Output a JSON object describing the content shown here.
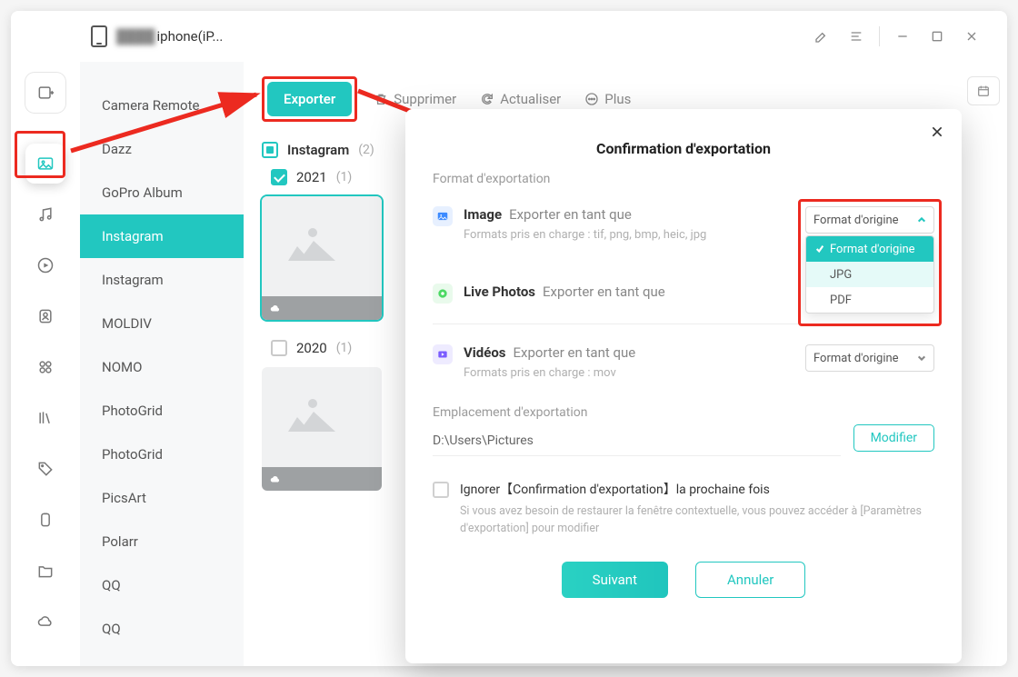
{
  "colors": {
    "accent": "#22c7c0",
    "danger_frame": "#ec2a20"
  },
  "titlebar": {
    "device_name_hidden_prefix": "████",
    "device_name_visible": "iphone(iP..."
  },
  "albums": [
    {
      "label": "Camera Remote",
      "selected": false
    },
    {
      "label": "Dazz",
      "selected": false
    },
    {
      "label": "GoPro Album",
      "selected": false
    },
    {
      "label": "Instagram",
      "selected": true
    },
    {
      "label": "Instagram",
      "selected": false
    },
    {
      "label": "MOLDIV",
      "selected": false
    },
    {
      "label": "NOMO",
      "selected": false
    },
    {
      "label": "PhotoGrid",
      "selected": false
    },
    {
      "label": "PhotoGrid",
      "selected": false
    },
    {
      "label": "PicsArt",
      "selected": false
    },
    {
      "label": "Polarr",
      "selected": false
    },
    {
      "label": "QQ",
      "selected": false
    },
    {
      "label": "QQ",
      "selected": false
    }
  ],
  "toolbar": {
    "export": "Exporter",
    "delete": "Supprimer",
    "refresh": "Actualiser",
    "more": "Plus"
  },
  "content": {
    "group_title": "Instagram",
    "group_count": "(2)",
    "year1": "2021",
    "year1_count": "(1)",
    "year2": "2020",
    "year2_count": "(1)"
  },
  "modal": {
    "title": "Confirmation d'exportation",
    "section_format": "Format d'exportation",
    "image_label": "Image",
    "export_as": "Exporter en tant que",
    "image_hint": "Formats pris en charge : tif, png, bmp, heic, jpg",
    "live_label": "Live Photos",
    "video_label": "Vidéos",
    "video_hint": "Formats pris en charge  : mov",
    "dd_selected": "Format d'origine",
    "dd_options": [
      "Format d'origine",
      "JPG",
      "PDF"
    ],
    "video_dd_selected": "Format d'origine",
    "location_label": "Emplacement d'exportation",
    "location_value": "D:\\Users\\Pictures",
    "modify": "Modifier",
    "ignore_label": "Ignorer【Confirmation d'exportation】la prochaine fois",
    "ignore_hint": "Si vous avez besoin de restaurer la fenêtre contextuelle, vous pouvez accéder à [Paramètres d'exportation] pour modifier",
    "next": "Suivant",
    "cancel": "Annuler"
  }
}
